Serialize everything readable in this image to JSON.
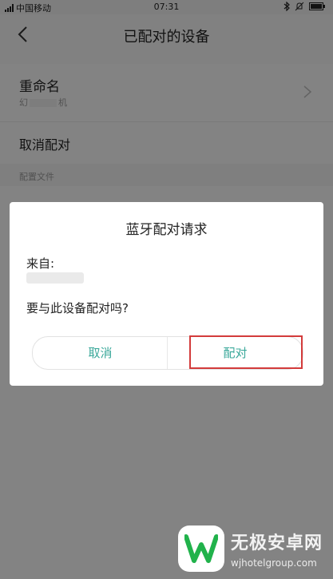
{
  "status_bar": {
    "carrier": "中国移动",
    "time": "07:31",
    "icons": [
      "signal-icon",
      "bluetooth-icon",
      "mute-icon",
      "battery-icon"
    ]
  },
  "nav": {
    "title": "已配对的设备",
    "back_icon": "chevron-left-icon"
  },
  "settings": {
    "rename_label": "重命名",
    "device_name_prefix": "幻",
    "device_name_suffix": "机",
    "unpair_label": "取消配对",
    "profiles_header": "配置文件"
  },
  "dialog": {
    "title": "蓝牙配对请求",
    "from_label": "来自:",
    "question": "要与此设备配对吗?",
    "cancel_label": "取消",
    "confirm_label": "配对"
  },
  "watermark": {
    "title": "无极安卓网",
    "url": "wjhotelgroup.com"
  },
  "colors": {
    "accent": "#3aa89a",
    "highlight": "#d33b3b",
    "logo_green": "#21b24b"
  }
}
